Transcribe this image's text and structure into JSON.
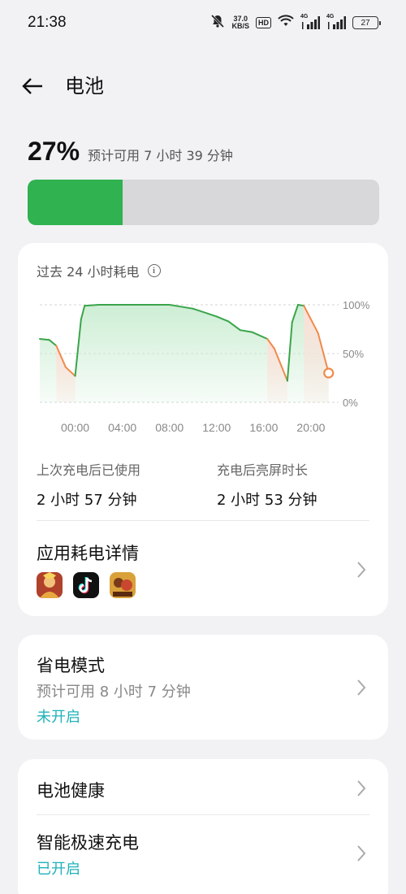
{
  "status_bar": {
    "time": "21:38",
    "speed_value": "37.0",
    "speed_unit": "KB/S",
    "hd_label": "HD",
    "signal1_label": "4G",
    "signal2_label": "4G",
    "battery_level": "27"
  },
  "header": {
    "title": "电池"
  },
  "battery": {
    "percent": "27%",
    "percent_value": 0.27,
    "estimate": "预计可用 7 小时 39 分钟",
    "fill_color": "#2fb24f"
  },
  "usage_card": {
    "title": "过去 24 小时耗电",
    "stats": [
      {
        "label": "上次充电后已使用",
        "value": "2 小时 57 分钟"
      },
      {
        "label": "充电后亮屏时长",
        "value": "2 小时 53 分钟"
      }
    ],
    "app_usage_title": "应用耗电详情",
    "apps": [
      "王者荣耀",
      "抖音",
      "游戏"
    ]
  },
  "chart_data": {
    "type": "area",
    "title": "过去 24 小时耗电",
    "x_ticks": [
      "00:00",
      "04:00",
      "08:00",
      "12:00",
      "16:00",
      "20:00"
    ],
    "y_ticks": [
      "100%",
      "50%",
      "0%"
    ],
    "ylim": [
      0,
      100
    ],
    "xlim": [
      -3,
      22
    ],
    "points": [
      {
        "x": -3,
        "y": 65
      },
      {
        "x": -2.2,
        "y": 64
      },
      {
        "x": -1.6,
        "y": 58
      },
      {
        "x": -0.8,
        "y": 36
      },
      {
        "x": 0,
        "y": 27
      },
      {
        "x": 0.5,
        "y": 85
      },
      {
        "x": 0.8,
        "y": 99
      },
      {
        "x": 2,
        "y": 100
      },
      {
        "x": 6,
        "y": 100
      },
      {
        "x": 8,
        "y": 100
      },
      {
        "x": 8.5,
        "y": 99
      },
      {
        "x": 10,
        "y": 96
      },
      {
        "x": 12,
        "y": 88
      },
      {
        "x": 13,
        "y": 83
      },
      {
        "x": 14,
        "y": 74
      },
      {
        "x": 15,
        "y": 72
      },
      {
        "x": 16.3,
        "y": 65
      },
      {
        "x": 16.9,
        "y": 55
      },
      {
        "x": 18.0,
        "y": 22
      },
      {
        "x": 18.4,
        "y": 82
      },
      {
        "x": 18.9,
        "y": 100
      },
      {
        "x": 19.4,
        "y": 99
      },
      {
        "x": 20.6,
        "y": 71
      },
      {
        "x": 21.5,
        "y": 30
      }
    ],
    "discharge_segments": [
      [
        -1.6,
        0
      ],
      [
        16.3,
        18.0
      ],
      [
        19.4,
        21.5
      ]
    ],
    "colors": {
      "charge": "#3aa54a",
      "discharge": "#f08a4b",
      "area": "#c8ecd0",
      "area_discharge": "#fde0d8"
    },
    "grid": true
  },
  "power_saving": {
    "title": "省电模式",
    "estimate": "预计可用 8 小时 7 分钟",
    "status": "未开启"
  },
  "health": {
    "title": "电池健康"
  },
  "fast_charge": {
    "title": "智能极速充电",
    "status": "已开启"
  },
  "accent_color": "#20b2b9"
}
